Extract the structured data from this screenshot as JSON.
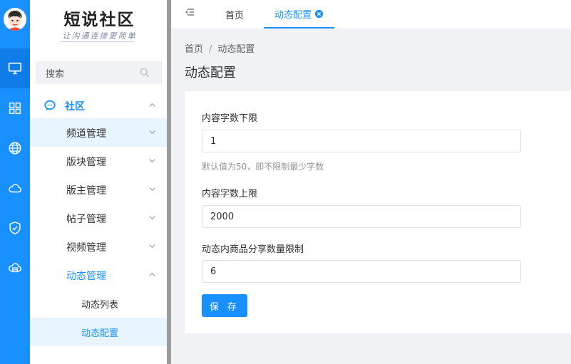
{
  "brand": {
    "title": "短说社区",
    "slogan": "让沟通连接更简单"
  },
  "sidebar": {
    "search_label": "搜索",
    "section": "社区",
    "items": [
      {
        "label": "频道管理"
      },
      {
        "label": "版块管理"
      },
      {
        "label": "版主管理"
      },
      {
        "label": "帖子管理"
      },
      {
        "label": "视频管理"
      },
      {
        "label": "动态管理"
      }
    ],
    "subitems": [
      {
        "label": "动态列表"
      },
      {
        "label": "动态配置"
      }
    ]
  },
  "tabs": {
    "home": "首页",
    "active": "动态配置"
  },
  "breadcrumb": {
    "home": "首页",
    "separator": "/",
    "current": "动态配置"
  },
  "page": {
    "title": "动态配置"
  },
  "form": {
    "min_label": "内容字数下限",
    "min_value": "1",
    "min_hint": "默认值为50，即不限制最少字数",
    "max_label": "内容字数上限",
    "max_value": "2000",
    "share_label": "动态内商品分享数量限制",
    "share_value": "6",
    "save": "保 存"
  },
  "colors": {
    "primary": "#1890ff",
    "rail": "#1890ff",
    "background": "#f0f2f5"
  }
}
